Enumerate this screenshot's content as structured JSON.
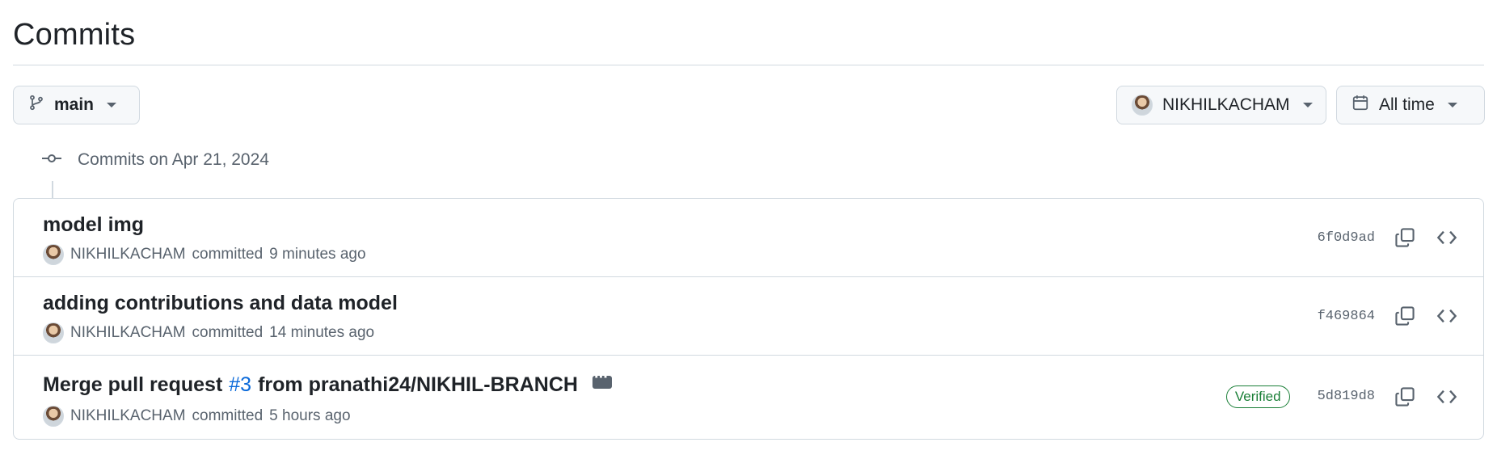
{
  "page": {
    "title": "Commits"
  },
  "filters": {
    "branch_label": "main",
    "user_label": "NIKHILKACHAM",
    "time_label": "All time"
  },
  "timeline": {
    "date_label": "Commits on Apr 21, 2024"
  },
  "commits": [
    {
      "message": "model img",
      "author": "NIKHILKACHAM",
      "action": "committed",
      "time": "9 minutes ago",
      "sha": "6f0d9ad"
    },
    {
      "message": "adding contributions and data model",
      "author": "NIKHILKACHAM",
      "action": "committed",
      "time": "14 minutes ago",
      "sha": "f469864"
    },
    {
      "message_prefix": "Merge pull request",
      "pr_number": "#3",
      "message_suffix": "from pranathi24/NIKHIL-BRANCH",
      "author": "NIKHILKACHAM",
      "action": "committed",
      "time": "5 hours ago",
      "badge": "Verified",
      "sha": "5d819d8"
    }
  ],
  "colors": {
    "link": "#0969da",
    "verified": "#1a7f37",
    "muted": "#59636e",
    "border": "#d1d9e0"
  }
}
